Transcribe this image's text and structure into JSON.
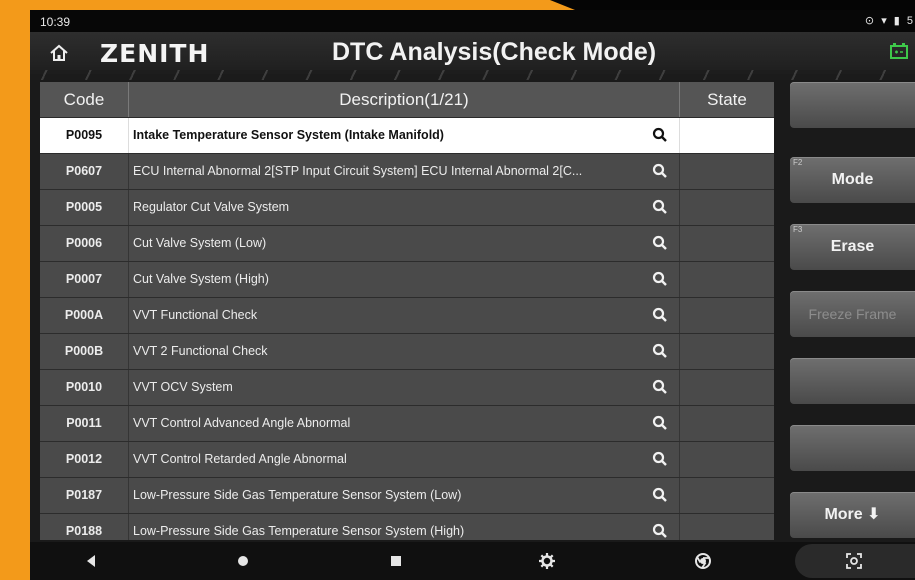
{
  "status_bar": {
    "time": "10:39",
    "icons": "⊙ ▾ ▮ 5"
  },
  "header": {
    "brand": "ZENITH",
    "title": "DTC Analysis(Check Mode)"
  },
  "table": {
    "columns": {
      "code": "Code",
      "description": "Description(1/21)",
      "state": "State"
    },
    "rows": [
      {
        "code": "P0095",
        "description": "Intake Temperature Sensor System (Intake Manifold)",
        "state": ""
      },
      {
        "code": "P0607",
        "description": "ECU Internal Abnormal 2[STP Input Circuit System] ECU Internal Abnormal 2[C...",
        "state": ""
      },
      {
        "code": "P0005",
        "description": "Regulator Cut Valve System",
        "state": ""
      },
      {
        "code": "P0006",
        "description": "Cut Valve System (Low)",
        "state": ""
      },
      {
        "code": "P0007",
        "description": "Cut Valve System (High)",
        "state": ""
      },
      {
        "code": "P000A",
        "description": "VVT Functional Check",
        "state": ""
      },
      {
        "code": "P000B",
        "description": "VVT 2 Functional Check",
        "state": ""
      },
      {
        "code": "P0010",
        "description": "VVT OCV System",
        "state": ""
      },
      {
        "code": "P0011",
        "description": "VVT Control Advanced Angle Abnormal",
        "state": ""
      },
      {
        "code": "P0012",
        "description": "VVT Control Retarded Angle Abnormal",
        "state": ""
      },
      {
        "code": "P0187",
        "description": "Low-Pressure Side Gas Temperature Sensor System (Low)",
        "state": ""
      },
      {
        "code": "P0188",
        "description": "Low-Pressure Side Gas Temperature Sensor System (High)",
        "state": ""
      }
    ]
  },
  "side_buttons": {
    "f2_key": "F2",
    "mode": "Mode",
    "f3_key": "F3",
    "erase": "Erase",
    "freeze_frame": "Freeze Frame",
    "more": "More ⬇"
  },
  "colors": {
    "frame_orange": "#f39a1a",
    "selected_row": "#ffffff",
    "row_bg": "#4a4a4a"
  }
}
